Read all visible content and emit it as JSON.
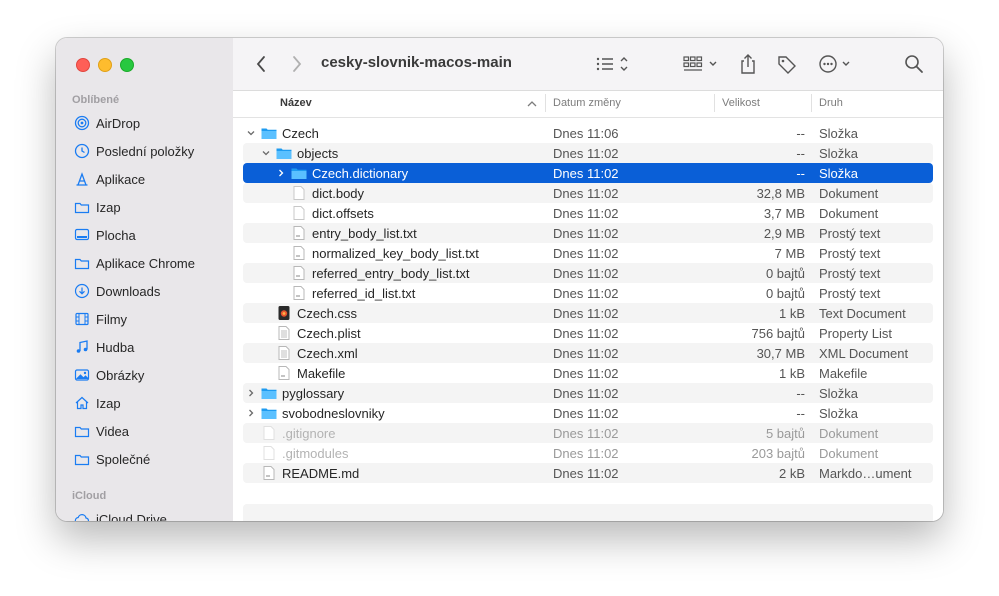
{
  "window": {
    "title": "cesky-slovnik-macos-main"
  },
  "sidebar": {
    "favorites_header": "Oblíbené",
    "items": [
      {
        "label": "AirDrop",
        "icon": "airdrop-icon"
      },
      {
        "label": "Poslední položky",
        "icon": "clock-icon"
      },
      {
        "label": "Aplikace",
        "icon": "applications-icon"
      },
      {
        "label": "Izap",
        "icon": "folder-icon"
      },
      {
        "label": "Plocha",
        "icon": "desktop-icon"
      },
      {
        "label": "Aplikace Chrome",
        "icon": "folder-icon"
      },
      {
        "label": "Downloads",
        "icon": "download-icon"
      },
      {
        "label": "Filmy",
        "icon": "film-icon"
      },
      {
        "label": "Hudba",
        "icon": "music-icon"
      },
      {
        "label": "Obrázky",
        "icon": "photo-icon"
      },
      {
        "label": "Izap",
        "icon": "home-icon"
      },
      {
        "label": "Videa",
        "icon": "folder-icon"
      },
      {
        "label": "Společné",
        "icon": "folder-icon"
      }
    ],
    "icloud_header": "iCloud",
    "icloud_items": [
      {
        "label": "iCloud Drive",
        "icon": "cloud-icon"
      }
    ]
  },
  "columns": {
    "name": "Název",
    "date": "Datum změny",
    "size": "Velikost",
    "kind": "Druh"
  },
  "files": [
    {
      "name": "Czech",
      "date": "Dnes 11:06",
      "size": "--",
      "kind": "Složka"
    },
    {
      "name": "objects",
      "date": "Dnes 11:02",
      "size": "--",
      "kind": "Složka"
    },
    {
      "name": "Czech.dictionary",
      "date": "Dnes 11:02",
      "size": "--",
      "kind": "Složka"
    },
    {
      "name": "dict.body",
      "date": "Dnes 11:02",
      "size": "32,8 MB",
      "kind": "Dokument"
    },
    {
      "name": "dict.offsets",
      "date": "Dnes 11:02",
      "size": "3,7 MB",
      "kind": "Dokument"
    },
    {
      "name": "entry_body_list.txt",
      "date": "Dnes 11:02",
      "size": "2,9 MB",
      "kind": "Prostý text"
    },
    {
      "name": "normalized_key_body_list.txt",
      "date": "Dnes 11:02",
      "size": "7 MB",
      "kind": "Prostý text"
    },
    {
      "name": "referred_entry_body_list.txt",
      "date": "Dnes 11:02",
      "size": "0 bajtů",
      "kind": "Prostý text"
    },
    {
      "name": "referred_id_list.txt",
      "date": "Dnes 11:02",
      "size": "0 bajtů",
      "kind": "Prostý text"
    },
    {
      "name": "Czech.css",
      "date": "Dnes 11:02",
      "size": "1 kB",
      "kind": "Text Document"
    },
    {
      "name": "Czech.plist",
      "date": "Dnes 11:02",
      "size": "756 bajtů",
      "kind": "Property List"
    },
    {
      "name": "Czech.xml",
      "date": "Dnes 11:02",
      "size": "30,7 MB",
      "kind": "XML Document"
    },
    {
      "name": "Makefile",
      "date": "Dnes 11:02",
      "size": "1 kB",
      "kind": "Makefile"
    },
    {
      "name": "pyglossary",
      "date": "Dnes 11:02",
      "size": "--",
      "kind": "Složka"
    },
    {
      "name": "svobodneslovniky",
      "date": "Dnes 11:02",
      "size": "--",
      "kind": "Složka"
    },
    {
      "name": ".gitignore",
      "date": "Dnes 11:02",
      "size": "5 bajtů",
      "kind": "Dokument"
    },
    {
      "name": ".gitmodules",
      "date": "Dnes 11:02",
      "size": "203 bajtů",
      "kind": "Dokument"
    },
    {
      "name": "README.md",
      "date": "Dnes 11:02",
      "size": "2 kB",
      "kind": "Markdo…ument"
    }
  ],
  "colors": {
    "selection": "#0a5fd7",
    "folder": "#1e9bf0"
  }
}
